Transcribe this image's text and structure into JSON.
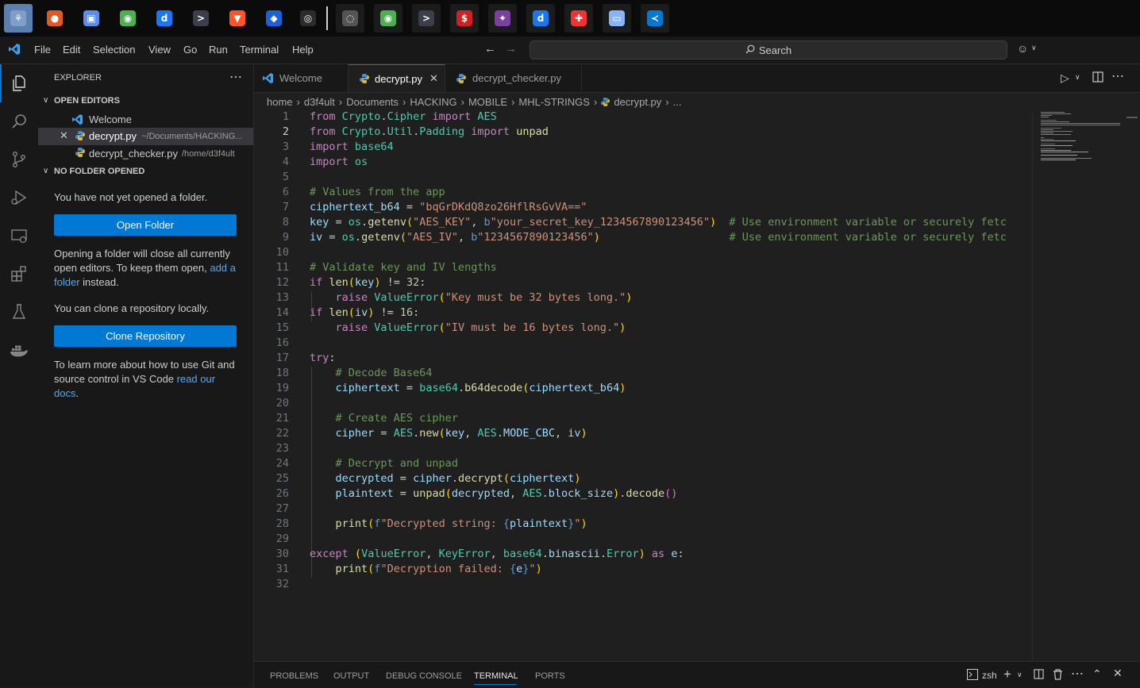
{
  "taskbar": {
    "apps": [
      {
        "name": "start-menu-icon",
        "color": "#7d9fc9",
        "glyph": "⚘"
      },
      {
        "name": "firefox-icon",
        "color": "#e25822",
        "glyph": "●"
      },
      {
        "name": "files-icon",
        "color": "#5b8def",
        "glyph": "▣"
      },
      {
        "name": "chrome-icon",
        "color": "#4caf50",
        "glyph": "◉"
      },
      {
        "name": "tiktok-icon",
        "color": "#1877f2",
        "glyph": "d"
      },
      {
        "name": "terminal-icon",
        "color": "#3a3f4b",
        "glyph": ">"
      },
      {
        "name": "brave-icon",
        "color": "#fb542b",
        "glyph": "▼"
      },
      {
        "name": "metasploit-icon",
        "color": "#1b60d6",
        "glyph": "◆"
      },
      {
        "name": "obs-icon",
        "color": "#2b2b2b",
        "glyph": "◎"
      },
      {
        "name": "burp-icon",
        "color": "#555555",
        "glyph": "◌"
      },
      {
        "name": "chrome-window-icon",
        "color": "#4caf50",
        "glyph": "◉"
      },
      {
        "name": "terminal-window-icon",
        "color": "#3a3f4b",
        "glyph": ">"
      },
      {
        "name": "red-terminal-icon",
        "color": "#cc2222",
        "glyph": "$"
      },
      {
        "name": "colorful-app-icon",
        "color": "#7b3fa0",
        "glyph": "✦"
      },
      {
        "name": "tiktok-window-icon",
        "color": "#1877f2",
        "glyph": "d"
      },
      {
        "name": "anydesk-icon",
        "color": "#ef3232",
        "glyph": "✚"
      },
      {
        "name": "files-window-icon",
        "color": "#8ab4f8",
        "glyph": "▭"
      },
      {
        "name": "vscode-window-icon",
        "color": "#0078d4",
        "glyph": "≺"
      }
    ]
  },
  "menubar": {
    "items": [
      "File",
      "Edit",
      "Selection",
      "View",
      "Go",
      "Run",
      "Terminal",
      "Help"
    ],
    "search_label": "Search"
  },
  "sidebar": {
    "title": "EXPLORER",
    "open_editors_title": "OPEN EDITORS",
    "open_editors": [
      {
        "name": "Welcome",
        "path": ""
      },
      {
        "name": "decrypt.py",
        "path": "~/Documents/HACKING..."
      },
      {
        "name": "decrypt_checker.py",
        "path": "/home/d3f4ult"
      }
    ],
    "no_folder_title": "NO FOLDER OPENED",
    "no_folder_msg": "You have not yet opened a folder.",
    "open_folder_button": "Open Folder",
    "opening_msg_1": "Opening a folder will close all currently open editors. To keep them open, ",
    "add_folder_link": "add a folder",
    "opening_msg_2": " instead.",
    "clone_msg": "You can clone a repository locally.",
    "clone_button": "Clone Repository",
    "learn_msg": "To learn more about how to use Git and source control in VS Code ",
    "docs_link": "read our docs",
    "learn_end": "."
  },
  "tabs": [
    {
      "label": "Welcome"
    },
    {
      "label": "decrypt.py"
    },
    {
      "label": "decrypt_checker.py"
    }
  ],
  "breadcrumb": [
    "home",
    "d3f4ult",
    "Documents",
    "HACKING",
    "MOBILE",
    "MHL-STRINGS",
    "decrypt.py",
    "..."
  ],
  "editor": {
    "current_line": 2,
    "line_numbers": [
      "1",
      "2",
      "3",
      "4",
      "5",
      "6",
      "7",
      "8",
      "9",
      "10",
      "11",
      "12",
      "13",
      "14",
      "15",
      "16",
      "17",
      "18",
      "19",
      "20",
      "21",
      "22",
      "23",
      "24",
      "25",
      "26",
      "27",
      "28",
      "29",
      "30",
      "31",
      "32"
    ]
  },
  "panel": {
    "tabs": [
      "PROBLEMS",
      "OUTPUT",
      "DEBUG CONSOLE",
      "TERMINAL",
      "PORTS"
    ],
    "active_tab": "TERMINAL",
    "shell": "zsh"
  },
  "colors": {
    "accent": "#0078d4",
    "link": "#4daafc",
    "background": "#1f1f1f"
  }
}
